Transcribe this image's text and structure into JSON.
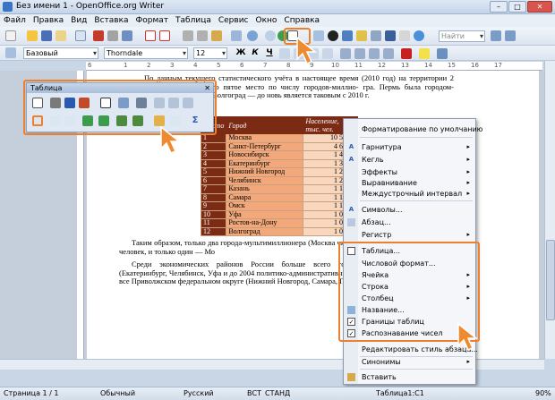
{
  "window": {
    "title": "Без имени 1 - OpenOffice.org Writer",
    "controls": [
      "–",
      "□",
      "✕"
    ]
  },
  "menu": [
    "Файл",
    "Правка",
    "Вид",
    "Вставка",
    "Формат",
    "Таблица",
    "Сервис",
    "Окно",
    "Справка"
  ],
  "formatting": {
    "style": "Базовый",
    "font": "Thorndale",
    "size": "12",
    "bold": "Ж",
    "italic": "К",
    "underline": "Ч",
    "find": "Найти"
  },
  "ruler_marks": [
    "6",
    "1",
    "2",
    "3",
    "4",
    "5",
    "6",
    "7",
    "8",
    "9",
    "10",
    "11",
    "12",
    "13",
    "14",
    "15",
    "16",
    "17"
  ],
  "document": {
    "para1": "По данным текущего статистического учёта в настоящее время (2010 год) на территории           2 городов-миллионеров, это пятое место по числу городов-миллио-          гра. Пермь была городом-миллионером до 2004 г., Волгоград — до          новь является таковым с 2010 г.",
    "para2": "Таким образом, только два города-мультимиллионера (Москва            численность населения более 2 млн человек, и только один — Мо",
    "para3": "Среди экономических районов России больше всего городов-            экономическом районе (Екатеринбург, Челябинск, Уфа и до 2004           политико-административным макрорайонированием больше все              Приволжском федеральном округе (Нижний Новгород, Самара,           Пермь)."
  },
  "table": {
    "headers": [
      "Место",
      "Город",
      "Население, тыс. чел."
    ],
    "rows": [
      {
        "num": "1",
        "city": "Москва",
        "pop": "10 563,0"
      },
      {
        "num": "2",
        "city": "Санкт-Петербург",
        "pop": "4 617,0"
      },
      {
        "num": "3",
        "city": "Новосибирск",
        "pop": "1 409,0"
      },
      {
        "num": "4",
        "city": "Екатеринбург",
        "pop": "1 365,0"
      },
      {
        "num": "5",
        "city": "Нижний Новгород",
        "pop": "1 278,0"
      },
      {
        "num": "6",
        "city": "Челябинск",
        "pop": "1 255,0"
      },
      {
        "num": "7",
        "city": "Казань",
        "pop": "1 138,0"
      },
      {
        "num": "8",
        "city": "Самара",
        "pop": "1 134,0"
      },
      {
        "num": "9",
        "city": "Омск",
        "pop": "1 134,0"
      },
      {
        "num": "10",
        "city": "Уфа",
        "pop": "1 064,0"
      },
      {
        "num": "11",
        "city": "Ростов-на-Дону",
        "pop": "1 048,0"
      },
      {
        "num": "12",
        "city": "Волгоград",
        "pop": "1 015,0"
      }
    ]
  },
  "table_toolbar": {
    "title": "Таблица",
    "close": "✕",
    "sum_icon": "Σ"
  },
  "context_menu": {
    "items": [
      "Форматирование по умолчанию",
      "Гарнитура",
      "Кегль",
      "Эффекты",
      "Выравнивание",
      "Междустрочный интервал",
      "Символы...",
      "Абзац...",
      "Регистр",
      "Таблица...",
      "Числовой формат...",
      "Ячейка",
      "Строка",
      "Столбец",
      "Название...",
      "Границы таблиц",
      "Распознавание чисел",
      "Редактировать стиль абзаца...",
      "Синонимы",
      "Вставить"
    ],
    "checkmark": "✓",
    "submenu_arrow": "▸"
  },
  "status": {
    "page": "Страница 1 / 1",
    "style": "Обычный",
    "lang": "Русский",
    "insert": "ВСТ",
    "mode": "СТАНД",
    "cell": "Таблица1:С1",
    "zoom": "90%"
  },
  "colors": {
    "highlight": "#ee7f2d",
    "table_header": "#7b2a14",
    "table_city": "#f2a87a",
    "table_pop": "#f9d7bf"
  }
}
